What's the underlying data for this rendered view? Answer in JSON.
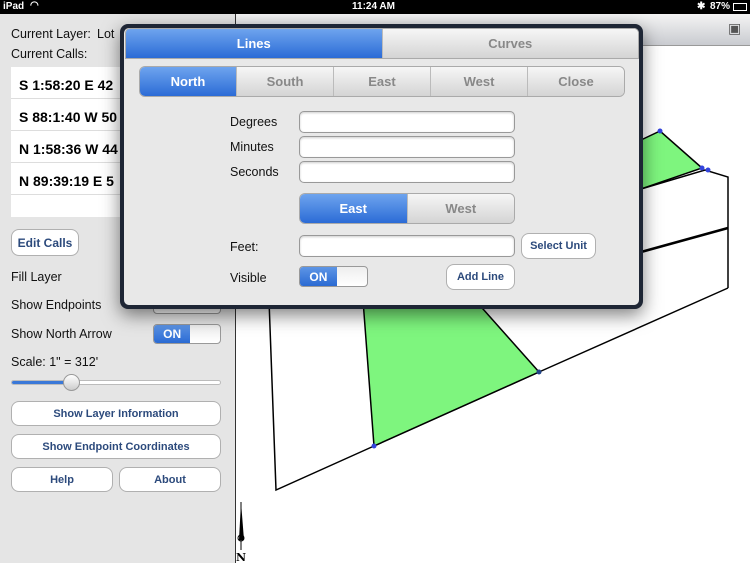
{
  "status": {
    "device": "iPad",
    "time": "11:24 AM",
    "battery": "87%"
  },
  "sidebar": {
    "current_layer_label": "Current Layer:",
    "current_layer_value": "Lot",
    "current_calls_label": "Current Calls:",
    "calls": [
      "S 1:58:20 E 42",
      "S 88:1:40 W 50",
      "N 1:58:36 W 44",
      "N 89:39:19 E 5"
    ],
    "edit_calls": "Edit Calls",
    "fill_layer": "Fill Layer",
    "show_endpoints": "Show Endpoints",
    "show_north_arrow": "Show North Arrow",
    "north_arrow_state": "ON",
    "scale_label": "Scale: 1\" = 312'",
    "scale_slider_fraction": 0.28,
    "show_layer_info": "Show Layer Information",
    "show_endpoint_coords": "Show Endpoint Coordinates",
    "help": "Help",
    "about": "About"
  },
  "popover": {
    "tabs": [
      "Lines",
      "Curves"
    ],
    "selected_tab": "Lines",
    "directions": [
      "North",
      "South",
      "East",
      "West",
      "Close"
    ],
    "selected_direction": "North",
    "degrees_label": "Degrees",
    "minutes_label": "Minutes",
    "seconds_label": "Seconds",
    "degrees": "",
    "minutes": "",
    "seconds": "",
    "ew": [
      "East",
      "West"
    ],
    "selected_ew": "East",
    "feet_label": "Feet:",
    "feet": "",
    "select_unit": "Select Unit",
    "visible_label": "Visible",
    "visible_state": "ON",
    "add_line": "Add Line"
  },
  "map": {
    "north_label": "N",
    "fill_color": "#7ef57e"
  }
}
